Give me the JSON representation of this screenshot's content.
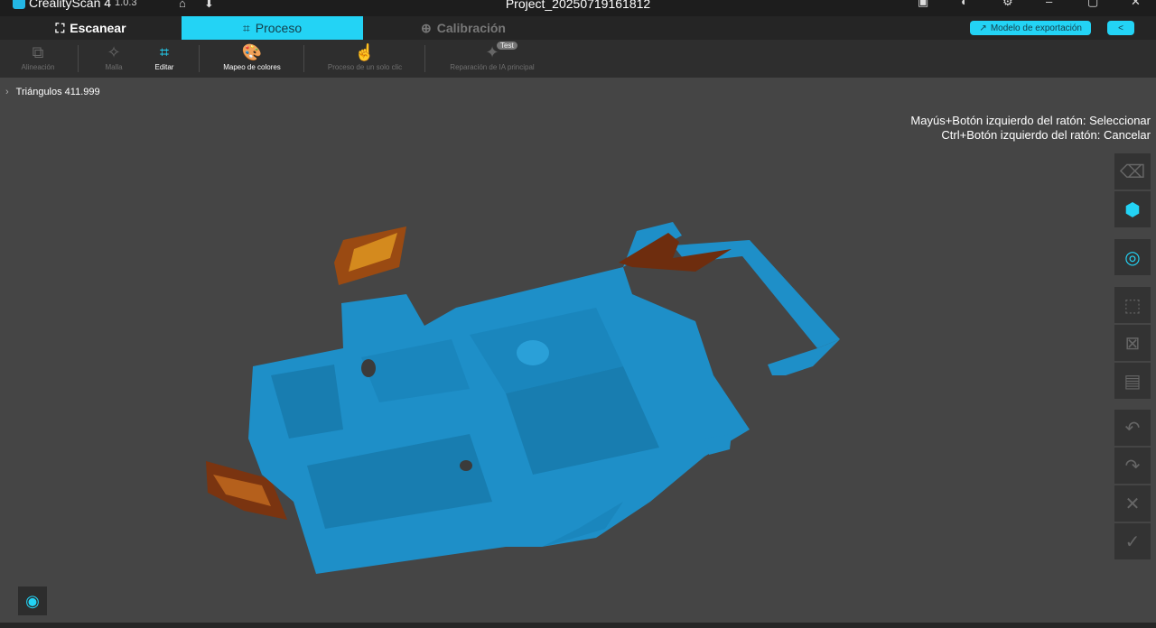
{
  "titlebar": {
    "app_name": "CrealityScan 4",
    "version": "1.0.3",
    "project": "Project_20250719161812",
    "home_icon": "home-icon",
    "save_icon": "save-icon"
  },
  "modes": {
    "scan": "Escanear",
    "process": "Proceso",
    "calibration": "Calibración"
  },
  "export": {
    "label": "Modelo de exportación"
  },
  "toolbar": {
    "alignment": "Alineación",
    "mesh": "Malla",
    "edit": "Editar",
    "color_mapping": "Mapeo de colores",
    "one_click": "Proceso de un solo clic",
    "ai_repair": "Reparación de IA principal",
    "test_badge": "Test"
  },
  "info": {
    "triangles": "Triángulos 411.999",
    "hint_select": "Mayús+Botón izquierdo del ratón: Seleccionar",
    "hint_cancel": "Ctrl+Botón izquierdo del ratón: Cancelar"
  },
  "colors": {
    "accent": "#23d3f5",
    "model_blue": "#1e8fc8",
    "texture_orange": "#c0651a"
  }
}
